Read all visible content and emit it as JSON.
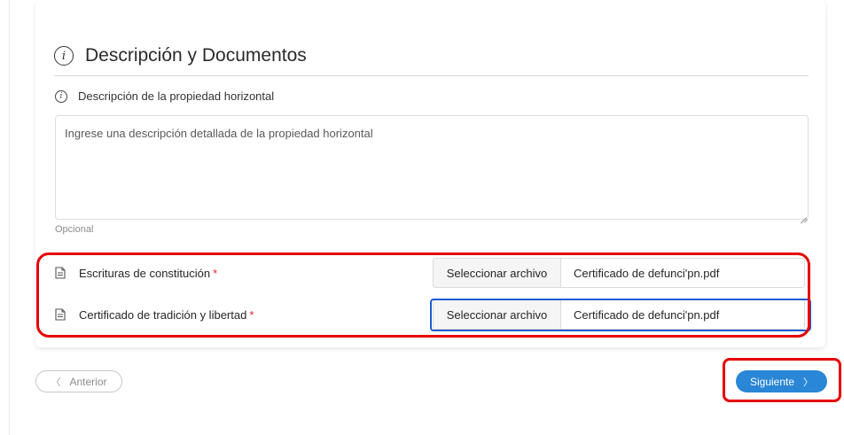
{
  "section": {
    "title": "Descripción y Documentos",
    "info_glyph": "i"
  },
  "description_field": {
    "label": "Descripción de la propiedad horizontal",
    "placeholder": "Ingrese una descripción detallada de la propiedad horizontal",
    "value": "",
    "helper": "Opcional"
  },
  "documents": [
    {
      "label": "Escrituras de constitución",
      "required_mark": "*",
      "button_label": "Seleccionar archivo",
      "file_name": "Certificado de defunci'pn.pdf"
    },
    {
      "label": "Certificado de tradición y libertad",
      "required_mark": "*",
      "button_label": "Seleccionar archivo",
      "file_name": "Certificado de defunci'pn.pdf"
    }
  ],
  "navigation": {
    "prev_label": "Anterior",
    "next_label": "Siguiente",
    "prev_chevron": "〈",
    "next_chevron": "〉"
  },
  "colors": {
    "primary": "#2a86d6",
    "required": "#e0282e",
    "annotation": "#e60000",
    "focus": "#1e5bd4"
  },
  "icons": {
    "section": "info-icon",
    "field": "info-icon",
    "document": "file-icon",
    "prev": "chevron-left-icon",
    "next": "chevron-right-icon"
  }
}
